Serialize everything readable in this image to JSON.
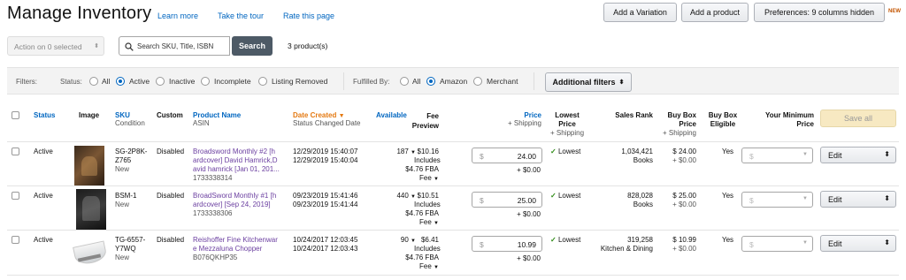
{
  "header": {
    "title": "Manage Inventory",
    "links": [
      "Learn more",
      "Take the tour",
      "Rate this page"
    ],
    "buttons": {
      "add_variation": "Add a Variation",
      "add_product": "Add a product",
      "preferences": "Preferences: 9 columns hidden"
    },
    "new_badge": "NEW"
  },
  "toolbar": {
    "action_select": "Action on 0 selected",
    "search_placeholder": "Search SKU, Title, ISBN",
    "search_button": "Search",
    "count": "3 product(s)"
  },
  "filters": {
    "label": "Filters:",
    "status_label": "Status:",
    "status_options": [
      "All",
      "Active",
      "Inactive",
      "Incomplete",
      "Listing Removed"
    ],
    "status_selected": "Active",
    "fulfilled_label": "Fulfilled By:",
    "fulfilled_options": [
      "All",
      "Amazon",
      "Merchant"
    ],
    "fulfilled_selected": "Amazon",
    "additional_button": "Additional filters"
  },
  "columns": {
    "status": "Status",
    "image": "Image",
    "sku": "SKU",
    "sku_sub": "Condition",
    "custom": "Custom",
    "product_name": "Product Name",
    "product_sub": "ASIN",
    "date_created": "Date Created",
    "date_sub": "Status Changed Date",
    "available": "Available",
    "fee_preview_1": "Fee",
    "fee_preview_2": "Preview",
    "price": "Price",
    "price_sub": "+ Shipping",
    "lowest_1": "Lowest",
    "lowest_2": "Price",
    "lowest_sub": "+ Shipping",
    "sales_rank": "Sales Rank",
    "buybox_1": "Buy Box",
    "buybox_2": "Price",
    "buybox_sub": "+ Shipping",
    "eligible_1": "Buy Box",
    "eligible_2": "Eligible",
    "min_price_1": "Your Minimum",
    "min_price_2": "Price",
    "save_all": "Save all"
  },
  "rows": [
    {
      "status": "Active",
      "sku_1": "SG-2P8K-",
      "sku_2": "Z765",
      "condition": "New",
      "custom": "Disabled",
      "name_1": "Broadsword Monthly #2 [h",
      "name_2": "ardcover] David Hamrick,D",
      "name_3": "avid hamrick [Jan 01, 201...",
      "asin": "1733338314",
      "date_created": "12/29/2019 15:40:07",
      "date_changed": "12/29/2019 15:40:04",
      "available": "187",
      "fee": "$10.16",
      "fee_includes": "Includes",
      "fee_fba": "$4.76 FBA",
      "fee_label": "Fee",
      "price_symbol": "$",
      "price": "24.00",
      "shipping": "+ $0.00",
      "lowest": "Lowest",
      "rank": "1,034,421",
      "rank_cat": "Books",
      "buybox": "$ 24.00",
      "buybox_ship": "+ $0.00",
      "eligible": "Yes",
      "min_symbol": "$",
      "edit": "Edit"
    },
    {
      "status": "Active",
      "sku_1": "BSM-1",
      "sku_2": "",
      "condition": "New",
      "custom": "Disabled",
      "name_1": "BroadSword Monthly #1 [h",
      "name_2": "ardcover] [Sep 24, 2019]",
      "name_3": "",
      "asin": "1733338306",
      "date_created": "09/23/2019 15:41:46",
      "date_changed": "09/23/2019 15:41:44",
      "available": "440",
      "fee": "$10.51",
      "fee_includes": "Includes",
      "fee_fba": "$4.76 FBA",
      "fee_label": "Fee",
      "price_symbol": "$",
      "price": "25.00",
      "shipping": "+ $0.00",
      "lowest": "Lowest",
      "rank": "828,028",
      "rank_cat": "Books",
      "buybox": "$ 25.00",
      "buybox_ship": "+ $0.00",
      "eligible": "Yes",
      "min_symbol": "$",
      "edit": "Edit"
    },
    {
      "status": "Active",
      "sku_1": "TG-6557-",
      "sku_2": "Y7WQ",
      "condition": "New",
      "custom": "Disabled",
      "name_1": "Reishoffer Fine Kitchenwar",
      "name_2": "e Mezzaluna Chopper",
      "name_3": "",
      "asin": "B076QKHP35",
      "date_created": "10/24/2017 12:03:45",
      "date_changed": "10/24/2017 12:03:43",
      "available": "90",
      "fee": "$6.41",
      "fee_includes": "Includes",
      "fee_fba": "$4.76 FBA",
      "fee_label": "Fee",
      "price_symbol": "$",
      "price": "10.99",
      "shipping": "+ $0.00",
      "lowest": "Lowest",
      "rank": "319,258",
      "rank_cat": "Kitchen & Dining",
      "buybox": "$ 10.99",
      "buybox_ship": "+ $0.00",
      "eligible": "Yes",
      "min_symbol": "$",
      "edit": "Edit"
    }
  ],
  "colors": {
    "link": "#0066c0",
    "product_link": "#6b3fa0",
    "sorted_column": "#e47911",
    "check": "#2e8b16",
    "search_button": "#4d5a66",
    "save_all_bg": "#f7e9c2"
  },
  "icons": [
    "search-icon",
    "sort-down-icon",
    "checkmark-icon",
    "dropdown-arrow-icon"
  ]
}
